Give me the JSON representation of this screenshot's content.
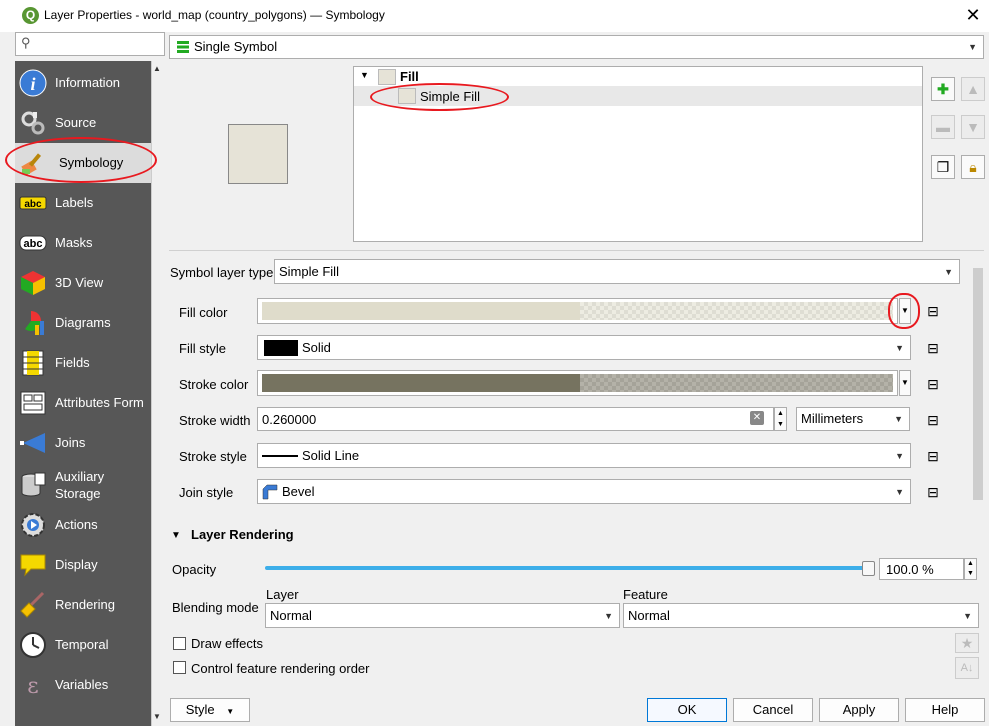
{
  "window": {
    "title": "Layer Properties - world_map (country_polygons) — Symbology",
    "logo": "Q"
  },
  "search": {
    "placeholder": ""
  },
  "sidebar": {
    "items": [
      {
        "label": "Information",
        "icon": "info-icon"
      },
      {
        "label": "Source",
        "icon": "source-icon"
      },
      {
        "label": "Symbology",
        "icon": "paintbrush-icon"
      },
      {
        "label": "Labels",
        "icon": "labels-icon"
      },
      {
        "label": "Masks",
        "icon": "masks-icon"
      },
      {
        "label": "3D View",
        "icon": "cube-icon"
      },
      {
        "label": "Diagrams",
        "icon": "diagrams-icon"
      },
      {
        "label": "Fields",
        "icon": "fields-icon"
      },
      {
        "label": "Attributes Form",
        "icon": "form-icon"
      },
      {
        "label": "Joins",
        "icon": "joins-icon"
      },
      {
        "label_line1": "Auxiliary",
        "label_line2": "Storage",
        "icon": "database-icon"
      },
      {
        "label": "Actions",
        "icon": "actions-icon"
      },
      {
        "label": "Display",
        "icon": "speech-bubble-icon"
      },
      {
        "label": "Rendering",
        "icon": "broom-icon"
      },
      {
        "label": "Temporal",
        "icon": "clock-icon"
      },
      {
        "label": "Variables",
        "icon": "epsilon-icon"
      }
    ],
    "selected": "Symbology"
  },
  "renderer": {
    "value": "Single Symbol"
  },
  "tree": {
    "root": "Fill",
    "child": "Simple Fill"
  },
  "form": {
    "symbol_layer_type_label": "Symbol layer type",
    "symbol_layer_type_value": "Simple Fill",
    "fill_color_label": "Fill color",
    "fill_style_label": "Fill style",
    "fill_style_value": "Solid",
    "stroke_color_label": "Stroke color",
    "stroke_width_label": "Stroke width",
    "stroke_width_value": "0.260000",
    "stroke_width_unit": "Millimeters",
    "stroke_style_label": "Stroke style",
    "stroke_style_value": "Solid Line",
    "join_style_label": "Join style",
    "join_style_value": "Bevel"
  },
  "colors": {
    "fill": "#dfdccb",
    "stroke": "#767360",
    "swatch": "#e6e3d7",
    "annotation": "#e8191f",
    "slider": "#3daee9"
  },
  "layer_rendering": {
    "title": "Layer Rendering",
    "opacity_label": "Opacity",
    "opacity_value": "100.0 %",
    "opacity_percent": 100,
    "blending_label": "Blending mode",
    "layer_label": "Layer",
    "layer_value": "Normal",
    "feature_label": "Feature",
    "feature_value": "Normal",
    "draw_effects": "Draw effects",
    "control_order": "Control feature rendering order"
  },
  "buttons": {
    "style": "Style",
    "ok": "OK",
    "cancel": "Cancel",
    "apply": "Apply",
    "help": "Help"
  }
}
